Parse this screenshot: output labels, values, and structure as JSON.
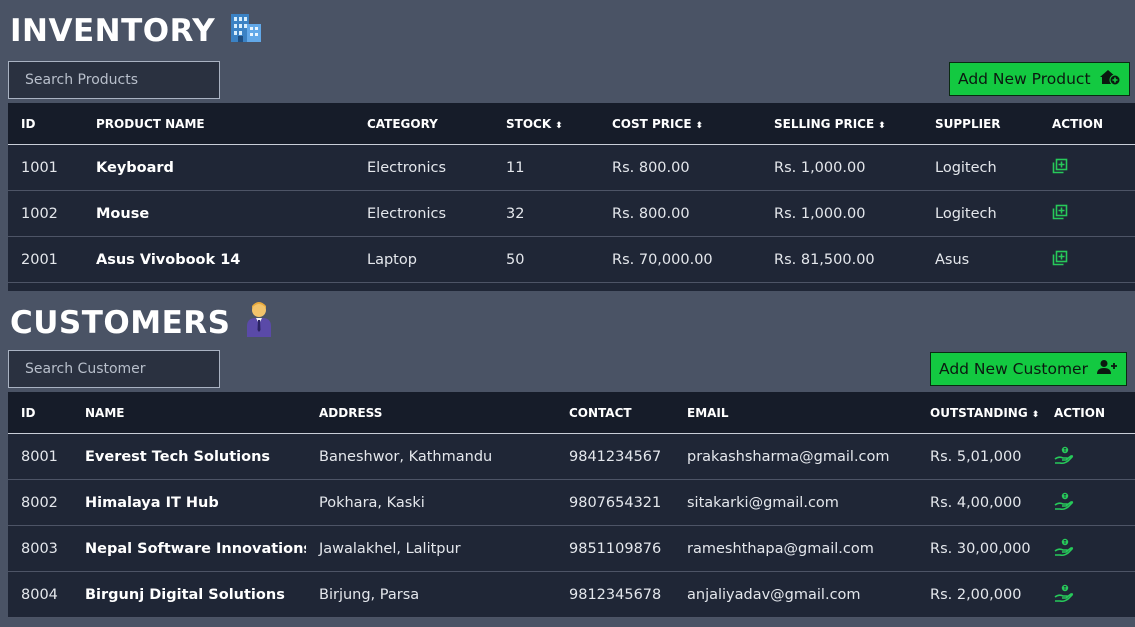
{
  "inventory": {
    "title": "INVENTORY",
    "title_icon": "office-building-icon",
    "search_placeholder": "Search Products",
    "add_button_label": "Add New Product",
    "add_button_icon": "add-product-icon",
    "columns": [
      "ID",
      "PRODUCT NAME",
      "CATEGORY",
      "STOCK",
      "COST PRICE",
      "SELLING PRICE",
      "SUPPLIER",
      "ACTION"
    ],
    "sort_symbol": "⬍",
    "rows": [
      {
        "id": "1001",
        "name": "Keyboard",
        "category": "Electronics",
        "stock": "11",
        "cost": "Rs. 800.00",
        "selling": "Rs. 1,000.00",
        "supplier": "Logitech"
      },
      {
        "id": "1002",
        "name": "Mouse",
        "category": "Electronics",
        "stock": "32",
        "cost": "Rs. 800.00",
        "selling": "Rs. 1,000.00",
        "supplier": "Logitech"
      },
      {
        "id": "2001",
        "name": "Asus Vivobook 14",
        "category": "Laptop",
        "stock": "50",
        "cost": "Rs. 70,000.00",
        "selling": "Rs. 81,500.00",
        "supplier": "Asus"
      }
    ],
    "row_action_icon": "add-stock-icon"
  },
  "customers": {
    "title": "CUSTOMERS",
    "title_icon": "businessman-icon",
    "search_placeholder": "Search Customer",
    "add_button_label": "Add New Customer",
    "add_button_icon": "add-user-icon",
    "columns": [
      "ID",
      "NAME",
      "ADDRESS",
      "CONTACT",
      "EMAIL",
      "OUTSTANDING",
      "ACTION"
    ],
    "rows": [
      {
        "id": "8001",
        "name": "Everest Tech Solutions",
        "address": "Baneshwor, Kathmandu",
        "contact": "9841234567",
        "email": "prakashsharma@gmail.com",
        "outstanding": "Rs. 5,01,000"
      },
      {
        "id": "8002",
        "name": "Himalaya IT Hub",
        "address": "Pokhara, Kaski",
        "contact": "9807654321",
        "email": "sitakarki@gmail.com",
        "outstanding": "Rs. 4,00,000"
      },
      {
        "id": "8003",
        "name": "Nepal Software Innovations",
        "address": "Jawalakhel, Lalitpur",
        "contact": "9851109876",
        "email": "rameshthapa@gmail.com",
        "outstanding": "Rs. 30,00,000"
      },
      {
        "id": "8004",
        "name": "Birgunj Digital Solutions",
        "address": "Birjung, Parsa",
        "contact": "9812345678",
        "email": "anjaliyadav@gmail.com",
        "outstanding": "Rs. 2,00,000"
      }
    ],
    "row_action_icon": "receive-payment-icon"
  },
  "colors": {
    "background": "#4a5365",
    "table_body": "#1f2636",
    "table_header": "#161c29",
    "accent_green": "#13c941",
    "icon_green": "#27c95a"
  }
}
